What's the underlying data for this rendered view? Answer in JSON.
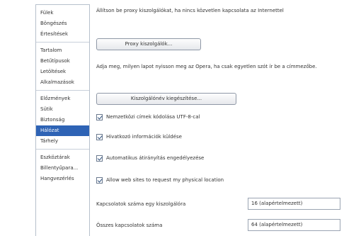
{
  "sidebar": {
    "groups": [
      [
        "Fülek",
        "Böngészés",
        "Értesítések"
      ],
      [
        "Tartalom",
        "Betűtípusok",
        "Letöltések",
        "Alkalmazások"
      ],
      [
        "Előzmények",
        "Sütik",
        "Biztonság",
        "Hálózat",
        "Tárhely"
      ],
      [
        "Eszköztárak",
        "Billentyűpara...",
        "Hangvezérlés"
      ]
    ],
    "active": "Hálózat"
  },
  "network": {
    "proxy_text": "Állítson be proxy kiszolgálókat, ha nincs közvetlen kapcsolata az Internettel",
    "proxy_button": "Proxy kiszolgálók...",
    "completion_text": "Adja meg, milyen lapot nyisson meg az Opera, ha csak egyetlen szót ír be a címmezőbe.",
    "completion_button": "Kiszolgálónév kiegészítése...",
    "checkboxes": [
      {
        "label": "Nemzetközi címek kódolása UTF-8-cal",
        "checked": true
      },
      {
        "label": "Hivatkozó információk küldése",
        "checked": true
      },
      {
        "label": "Automatikus átirányítás engedélyezése",
        "checked": true
      },
      {
        "label": "Allow web sites to request my physical location",
        "checked": true
      }
    ],
    "per_server_label": "Kapcsolatok száma egy kiszolgálóra",
    "per_server_value": "16 (alapértelmezett)",
    "total_label": "Összes kapcsolatok száma",
    "total_value": "64 (alapértelmezett)"
  }
}
